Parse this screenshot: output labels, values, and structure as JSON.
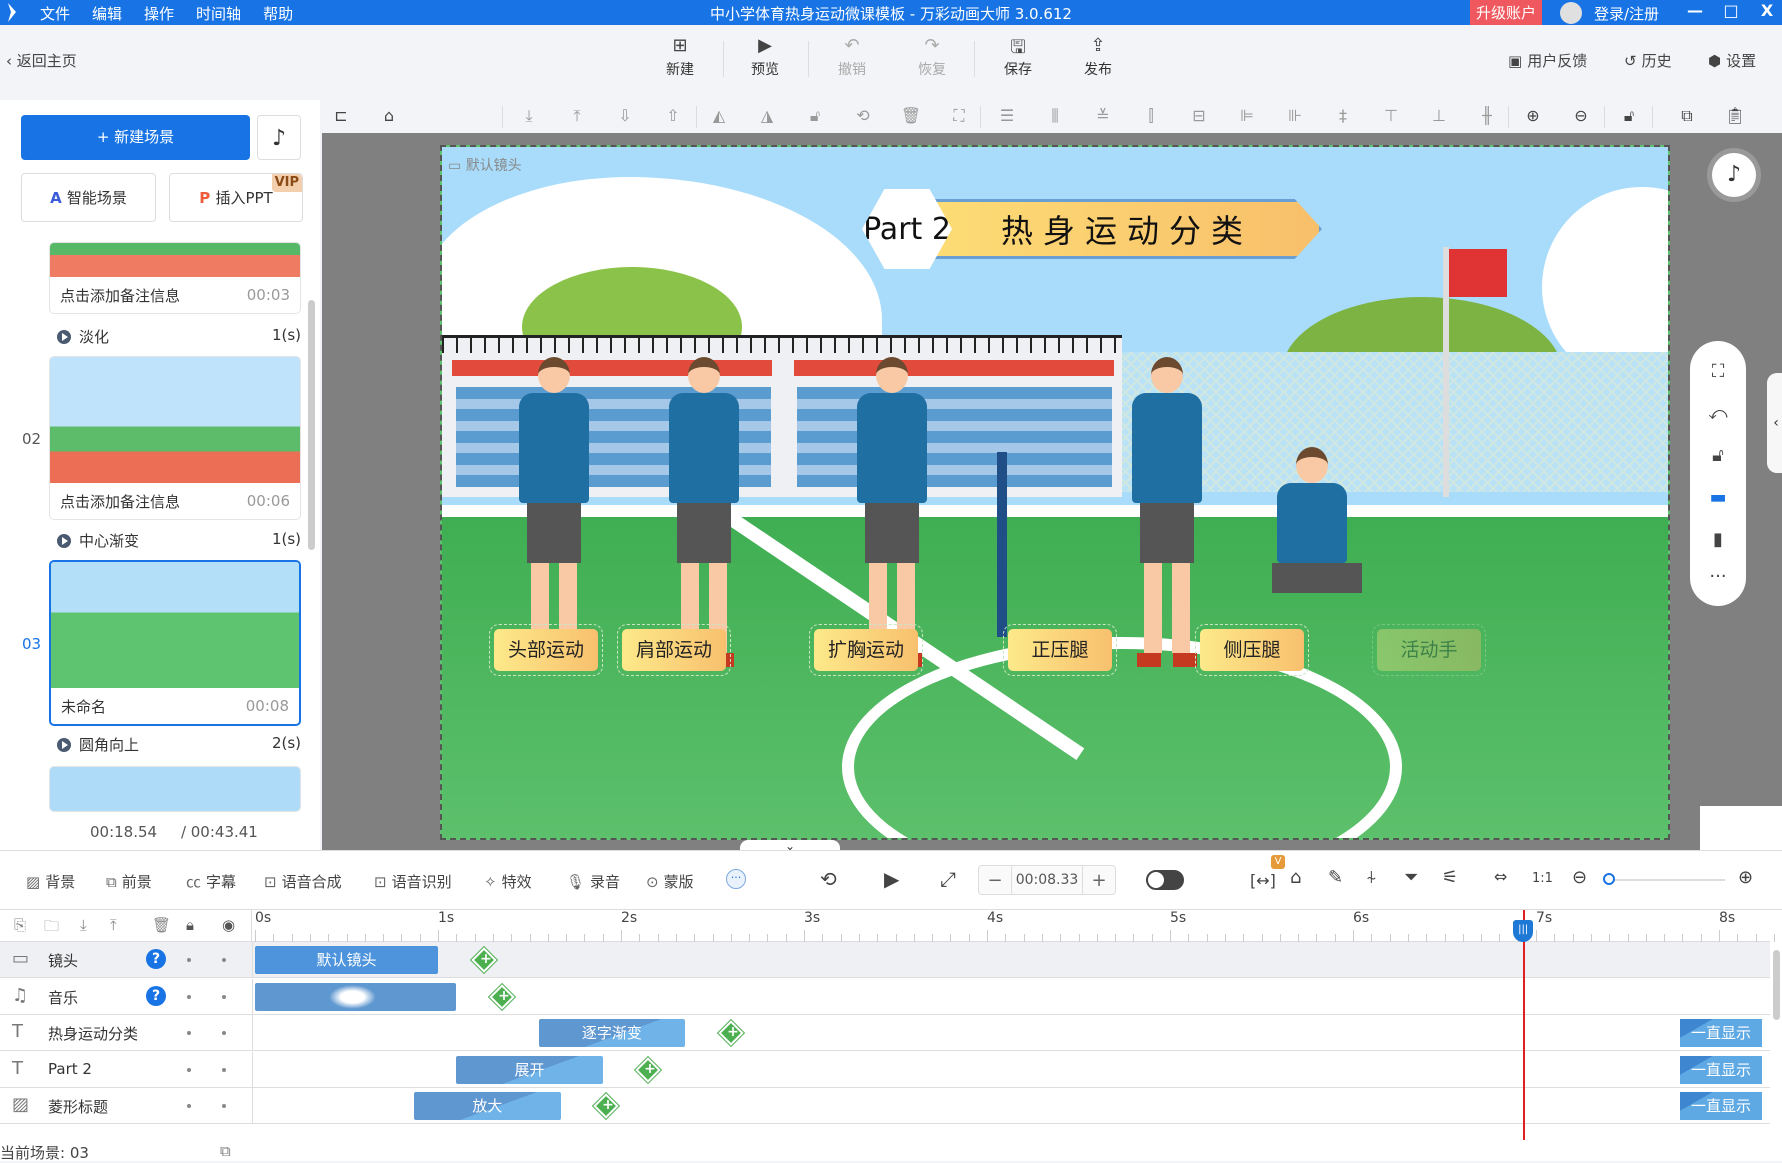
{
  "titlebar": {
    "menu": [
      "文件",
      "编辑",
      "操作",
      "时间轴",
      "帮助"
    ],
    "title": "中小学体育热身运动微课模板 - 万彩动画大师 3.0.612",
    "upgrade": "升级账户",
    "login": "登录/注册",
    "minimize": "—",
    "maximize": "□",
    "close": "X",
    "accent": "#1874e4"
  },
  "toolbar": {
    "back": "返回主页",
    "buttons": [
      {
        "label": "新建",
        "icon": "plus-square-icon"
      },
      {
        "label": "预览",
        "icon": "play-icon"
      },
      {
        "label": "撤销",
        "icon": "undo-icon",
        "disabled": true
      },
      {
        "label": "恢复",
        "icon": "redo-icon",
        "disabled": true
      },
      {
        "label": "保存",
        "icon": "save-icon"
      },
      {
        "label": "发布",
        "icon": "publish-icon"
      }
    ],
    "right": [
      {
        "label": "用户反馈",
        "icon": "feedback-icon"
      },
      {
        "label": "历史",
        "icon": "history-icon"
      },
      {
        "label": "设置",
        "icon": "settings-icon"
      }
    ]
  },
  "leftpanel": {
    "new_scene": "+ 新建场景",
    "smart_scene": "智能场景",
    "insert_ppt": "插入PPT",
    "vip": "VIP",
    "scenes": [
      {
        "number": "",
        "note": "点击添加备注信息",
        "duration": "00:03",
        "transition": "淡化",
        "transition_time": "1(s)"
      },
      {
        "number": "02",
        "note": "点击添加备注信息",
        "duration": "00:06",
        "transition": "中心渐变",
        "transition_time": "1(s)"
      },
      {
        "number": "03",
        "note": "未命名",
        "duration": "00:08",
        "transition": "圆角向上",
        "transition_time": "2(s)",
        "selected": true
      }
    ],
    "current_time": "00:18.54",
    "total_time": "/ 00:43.41"
  },
  "canvas": {
    "camera_label": "默认镜头",
    "part": "Part 2",
    "heading": "热身运动分类",
    "labels": [
      "头部运动",
      "肩部运动",
      "扩胸运动",
      "正压腿",
      "侧压腿",
      "活动手"
    ]
  },
  "bottomtoolbar": {
    "tools": [
      {
        "label": "背景",
        "icon": "background-icon"
      },
      {
        "label": "前景",
        "icon": "foreground-icon"
      },
      {
        "label": "字幕",
        "icon": "subtitle-icon"
      },
      {
        "label": "语音合成",
        "icon": "tts-icon"
      },
      {
        "label": "语音识别",
        "icon": "speech-recognition-icon"
      },
      {
        "label": "特效",
        "icon": "effects-icon"
      },
      {
        "label": "录音",
        "icon": "microphone-icon"
      },
      {
        "label": "蒙版",
        "icon": "mask-icon"
      }
    ],
    "time_value": "00:08.33",
    "v_badge": "V"
  },
  "timeline": {
    "ruler": [
      "0s",
      "1s",
      "2s",
      "3s",
      "4s",
      "5s",
      "6s",
      "7s",
      "8s"
    ],
    "playhead_seconds": 6.93,
    "tracks": [
      {
        "name": "镜头",
        "icon": "camera-icon",
        "help": true,
        "clip": "默认镜头",
        "start": 0,
        "end": 1.0,
        "keyframe": 1.25
      },
      {
        "name": "音乐",
        "icon": "music-icon",
        "help": true,
        "clip": "",
        "start": 0,
        "end": 1.1,
        "keyframe": 1.35
      },
      {
        "name": "热身运动分类",
        "icon": "text-icon",
        "clip": "逐字渐变",
        "start": 1.55,
        "end": 2.35,
        "keyframe": 2.6,
        "end_label": "一直显示"
      },
      {
        "name": "Part 2",
        "icon": "text-icon",
        "clip": "展开",
        "start": 1.1,
        "end": 1.9,
        "keyframe": 2.15,
        "end_label": "一直显示"
      },
      {
        "name": "菱形标题",
        "icon": "image-icon",
        "clip": "放大",
        "start": 0.87,
        "end": 1.67,
        "keyframe": 1.92,
        "end_label": "一直显示"
      }
    ],
    "current_scene": "当前场景: 03"
  }
}
